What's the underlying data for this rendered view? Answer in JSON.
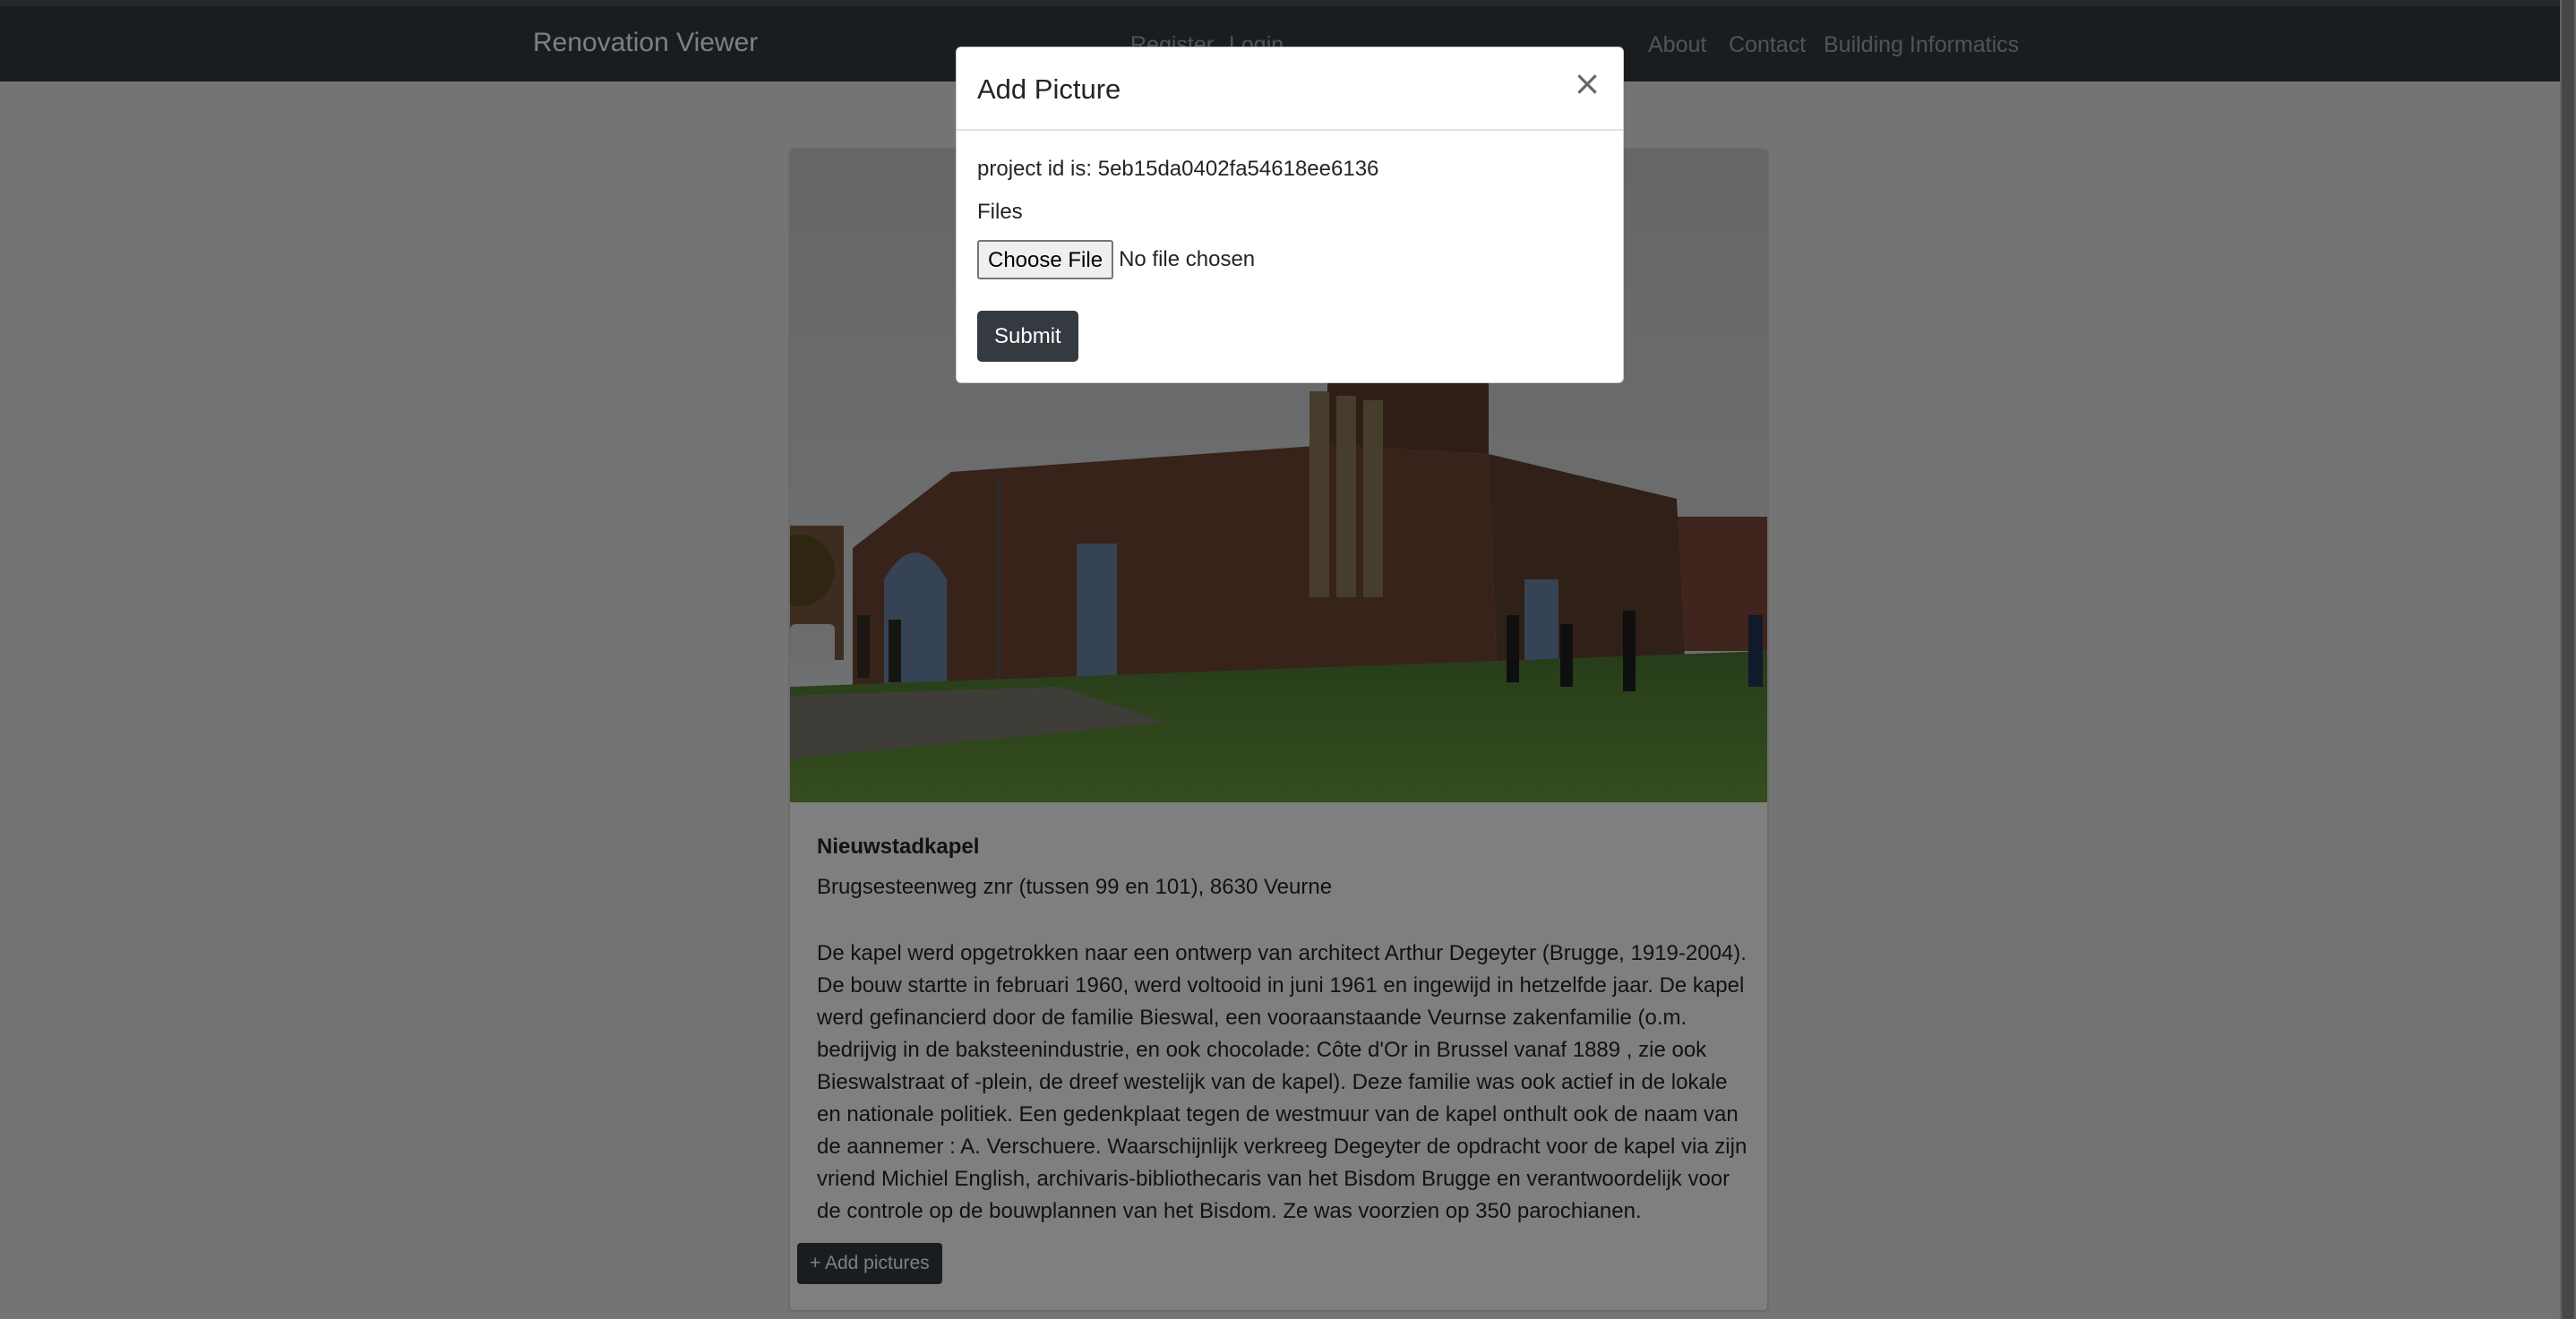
{
  "navbar": {
    "brand": "Renovation Viewer",
    "links": [
      "Register",
      "Login",
      "About",
      "Contact",
      "Building Informatics"
    ]
  },
  "card": {
    "photo_icon": "church-photo",
    "title": "Nieuwstadkapel",
    "address": "Brugsesteenweg znr (tussen 99 en 101), 8630 Veurne",
    "description": "De kapel werd opgetrokken naar een ontwerp van architect Arthur Degeyter (Brugge, 1919-2004). De bouw startte in februari 1960, werd voltooid in juni 1961 en ingewijd in hetzelfde jaar. De kapel werd gefinancierd door de familie Bieswal, een vooraanstaande Veurnse zakenfamilie (o.m. bedrijvig in de baksteenindustrie, en ook chocolade: Côte d'Or in Brussel vanaf 1889 , zie ook Bieswalstraat of -plein, de dreef westelijk van de kapel). Deze familie was ook actief in de lokale en nationale politiek. Een gedenkplaat tegen de westmuur van de kapel onthult ook de naam van de aannemer : A. Verschuere. Waarschijnlijk verkreeg Degeyter de opdracht voor de kapel via zijn vriend Michiel English, archivaris-bibliothecaris van het Bisdom Brugge en verantwoordelijk voor de controle op de bouwplannen van het Bisdom. Ze was voorzien op 350 parochianen.",
    "add_pictures_label": "+ Add pictures"
  },
  "modal": {
    "title": "Add Picture",
    "close_label": "×",
    "project_id_text": "project id is: 5eb15da0402fa54618ee6136",
    "files_label": "Files",
    "choose_file_label": "Choose File",
    "no_file_text": "No file chosen",
    "submit_label": "Submit"
  },
  "colors": {
    "navbar_bg": "#343a40",
    "button_dark": "#343a40",
    "backdrop": "rgba(0,0,0,0.5)"
  }
}
